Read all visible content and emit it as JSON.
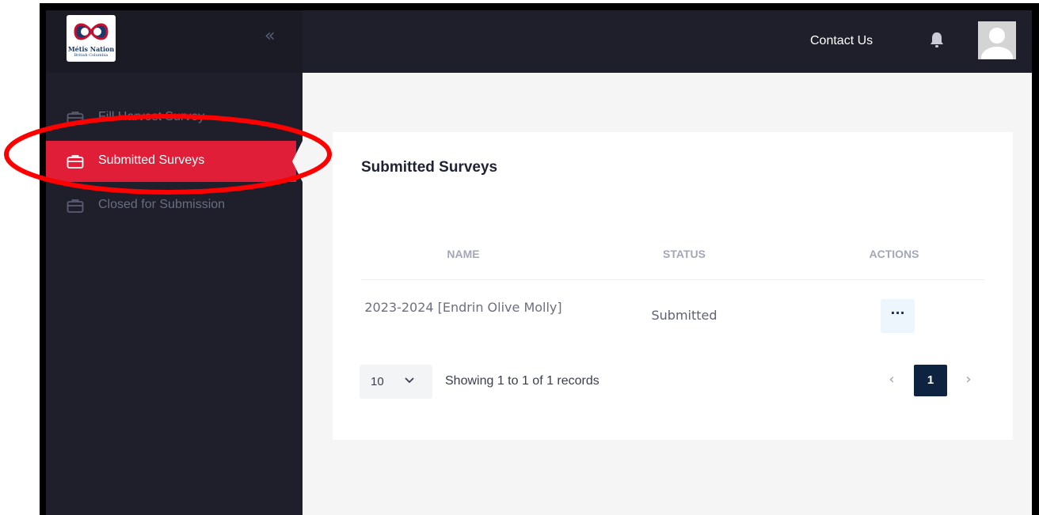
{
  "header": {
    "logo_line1": "Métis Nation",
    "logo_line2": "British Columbia",
    "contact_label": "Contact Us"
  },
  "sidebar": {
    "items": [
      {
        "label": "Fill Harvest Survey",
        "active": false
      },
      {
        "label": "Submitted Surveys",
        "active": true
      },
      {
        "label": "Closed for Submission",
        "active": false
      }
    ]
  },
  "main": {
    "title": "Submitted Surveys",
    "table": {
      "columns": [
        "NAME",
        "STATUS",
        "ACTIONS"
      ],
      "rows": [
        {
          "name": "2023-2024 [Endrin Olive Molly]",
          "status": "Submitted",
          "action": "···"
        }
      ]
    },
    "pagination": {
      "page_size": "10",
      "summary": "Showing 1 to 1 of 1 records",
      "current_page": "1"
    }
  },
  "colors": {
    "header_bg": "#1f1f2b",
    "sidebar_bg": "#1e1f2b",
    "active_item": "#e01e37",
    "current_page_bg": "#0d2340",
    "annotation_ring": "#ff0000"
  },
  "icons": {
    "collapse": "double-chevron-left-icon",
    "bell": "bell-icon",
    "avatar": "user-avatar-icon",
    "nav": "briefcase-icon"
  }
}
